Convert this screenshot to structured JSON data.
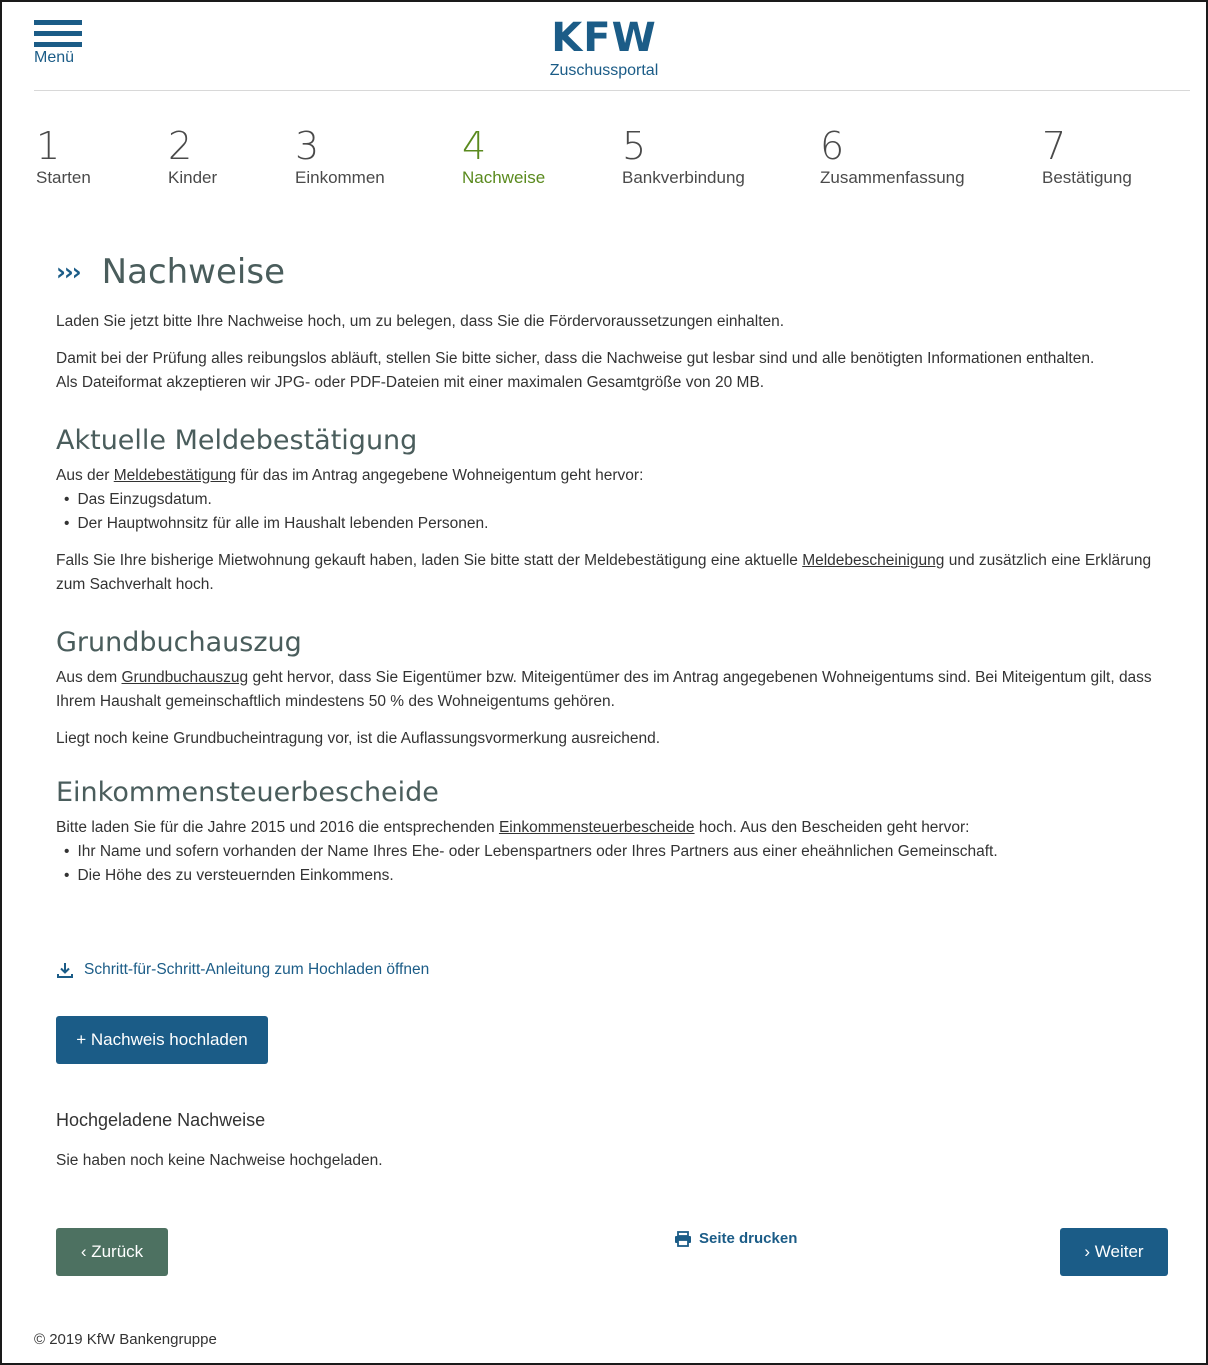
{
  "header": {
    "menu_label": "Menü",
    "brand": "KFW",
    "subtitle": "Zuschussportal"
  },
  "steps": [
    {
      "num": "1",
      "label": "Starten"
    },
    {
      "num": "2",
      "label": "Kinder"
    },
    {
      "num": "3",
      "label": "Einkommen"
    },
    {
      "num": "4",
      "label": "Nachweise"
    },
    {
      "num": "5",
      "label": "Bankverbindung"
    },
    {
      "num": "6",
      "label": "Zusammenfassung"
    },
    {
      "num": "7",
      "label": "Bestätigung"
    }
  ],
  "active_step": "4",
  "page": {
    "chevron": "›››",
    "title": "Nachweise",
    "intro1": "Laden Sie jetzt bitte Ihre Nachweise hoch, um zu belegen, dass Sie die Fördervoraussetzungen einhalten.",
    "intro2a": "Damit bei der Prüfung alles reibungslos abläuft, stellen Sie bitte sicher, dass die Nachweise gut lesbar sind und alle benötigten Informationen enthalten.",
    "intro2b": "Als Dateiformat akzeptieren wir JPG- oder PDF-Dateien mit einer maximalen Gesamtgröße von 20 MB."
  },
  "meldebestaetigung": {
    "heading": "Aktuelle Meldebestätigung",
    "p1_pre": "Aus der ",
    "p1_link": "Meldebestätigung",
    "p1_post": " für das im Antrag angegebene Wohneigentum geht hervor:",
    "items": [
      "Das Einzugsdatum.",
      "Der Hauptwohnsitz für alle im Haushalt lebenden Personen."
    ],
    "p2_pre": "Falls Sie Ihre bisherige Mietwohnung gekauft haben, laden Sie bitte statt der Meldebestätigung eine aktuelle ",
    "p2_link": "Meldebescheinigung",
    "p2_post": " und zusätzlich eine Erklärung zum Sachverhalt hoch."
  },
  "grundbuch": {
    "heading": "Grundbuchauszug",
    "p1_pre": "Aus dem ",
    "p1_link": "Grundbuchauszug",
    "p1_post": " geht hervor, dass Sie Eigentümer bzw. Miteigentümer des im Antrag angegebenen Wohneigentums sind. Bei Miteigentum gilt, dass Ihrem Haushalt gemeinschaftlich mindestens 50 % des Wohneigentums gehören.",
    "p2": "Liegt noch keine Grundbucheintragung vor, ist die Auflassungsvormerkung ausreichend."
  },
  "einkommen": {
    "heading": "Einkommensteuerbescheide",
    "p1_pre": "Bitte laden Sie für die Jahre 2015 und 2016 die entsprechenden ",
    "p1_link": "Einkommensteuerbescheide",
    "p1_post": " hoch. Aus den Bescheiden geht hervor:",
    "items": [
      "Ihr Name und sofern vorhanden der Name Ihres Ehe- oder Lebenspartners oder Ihres Partners aus einer eheähnlichen Gemeinschaft.",
      "Die Höhe des zu versteuernden Einkommens."
    ]
  },
  "actions": {
    "guide_link": "Schritt-für-Schritt-Anleitung zum Hochladen öffnen",
    "upload_button": "+ Nachweis hochladen",
    "uploaded_heading": "Hochgeladene Nachweise",
    "uploaded_empty": "Sie haben noch keine Nachweise hochgeladen.",
    "back_button": "‹  Zurück",
    "print_link": "Seite drucken",
    "next_button": "›  Weiter"
  },
  "footer": {
    "copyright": "© 2019 KfW Bankengruppe"
  },
  "colors": {
    "primary": "#1b5c87",
    "active_step": "#5a8a1e",
    "back_button": "#4d7161",
    "heading": "#4a5d5c"
  },
  "icons": {
    "menu": "hamburger-icon",
    "download": "download-icon",
    "print": "printer-icon"
  }
}
